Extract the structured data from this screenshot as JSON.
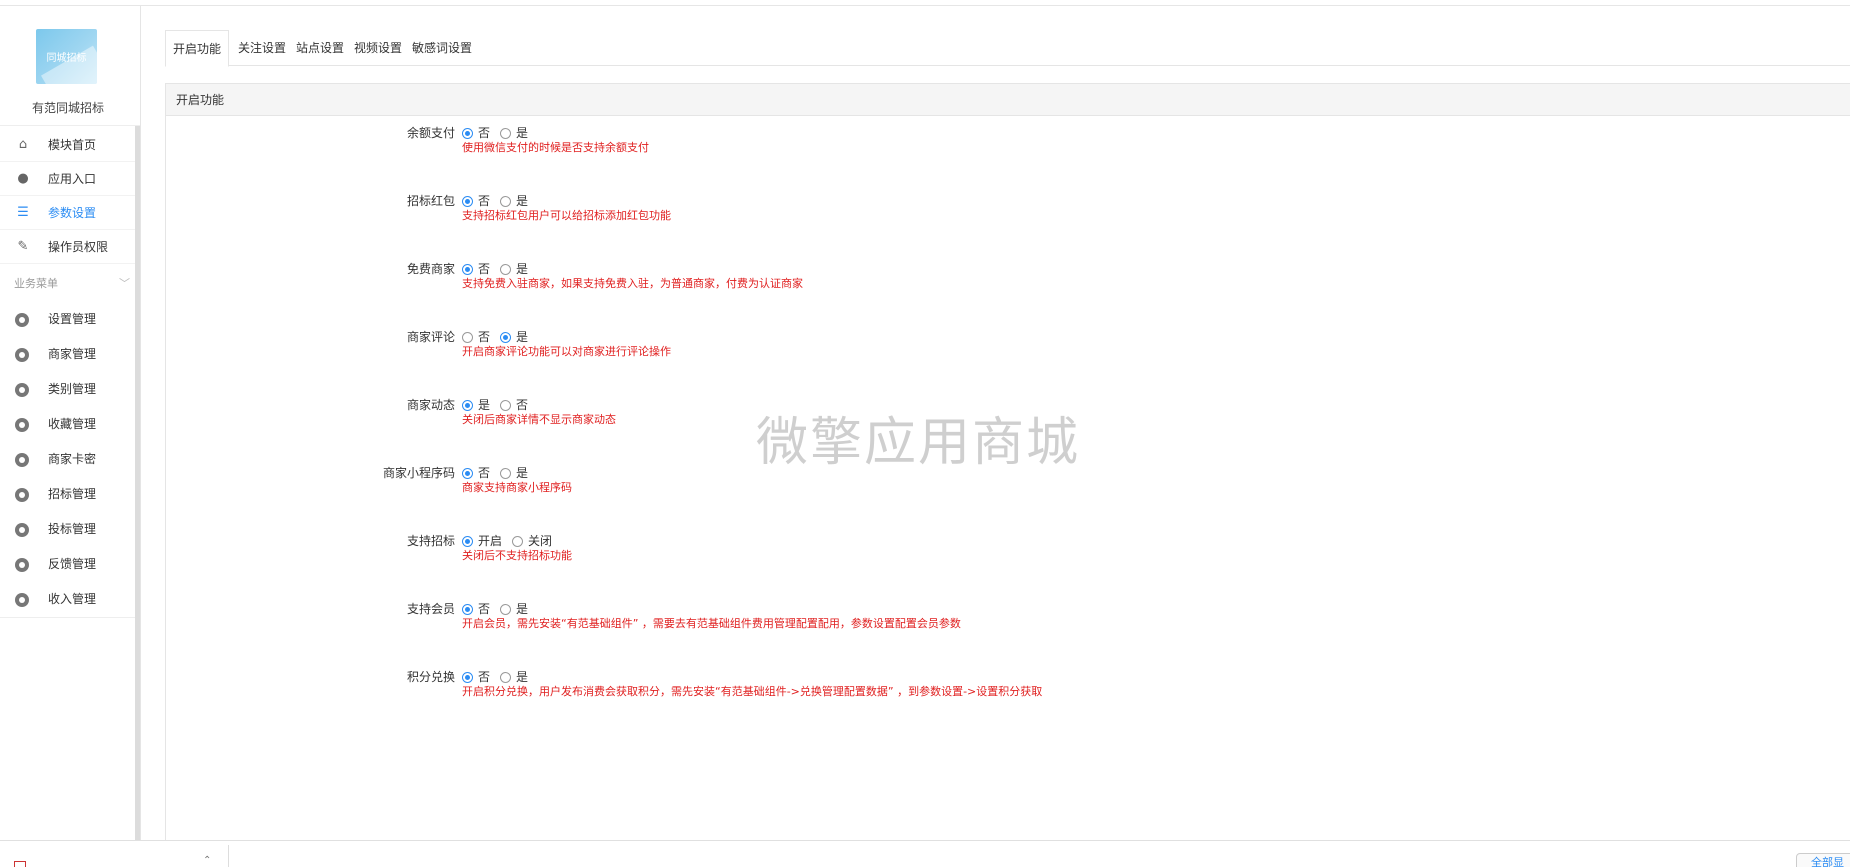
{
  "brand": {
    "logo_text": "同城招标",
    "name": "有范同城招标"
  },
  "nav": [
    {
      "label": "模块首页",
      "icon": "home-icon",
      "active": false
    },
    {
      "label": "应用入口",
      "icon": "chat-icon",
      "active": false
    },
    {
      "label": "参数设置",
      "icon": "list-icon",
      "active": true
    },
    {
      "label": "操作员权限",
      "icon": "edit-icon",
      "active": false
    }
  ],
  "business_menu": {
    "title": "业务菜单",
    "items": [
      "设置管理",
      "商家管理",
      "类别管理",
      "收藏管理",
      "商家卡密",
      "招标管理",
      "投标管理",
      "反馈管理",
      "收入管理"
    ]
  },
  "tabs": [
    "开启功能",
    "关注设置",
    "站点设置",
    "视频设置",
    "敏感词设置"
  ],
  "panel_title": "开启功能",
  "settings": [
    {
      "label": "余额支付",
      "options": [
        "否",
        "是"
      ],
      "selected": 0,
      "hint": "使用微信支付的时候是否支持余额支付"
    },
    {
      "label": "招标红包",
      "options": [
        "否",
        "是"
      ],
      "selected": 0,
      "hint": "支持招标红包用户可以给招标添加红包功能"
    },
    {
      "label": "免费商家",
      "options": [
        "否",
        "是"
      ],
      "selected": 0,
      "hint": "支持免费入驻商家，如果支持免费入驻，为普通商家，付费为认证商家"
    },
    {
      "label": "商家评论",
      "options": [
        "否",
        "是"
      ],
      "selected": 1,
      "hint": "开启商家评论功能可以对商家进行评论操作"
    },
    {
      "label": "商家动态",
      "options": [
        "是",
        "否"
      ],
      "selected": 0,
      "hint": "关闭后商家详情不显示商家动态"
    },
    {
      "label": "商家小程序码",
      "options": [
        "否",
        "是"
      ],
      "selected": 0,
      "hint": "商家支持商家小程序码"
    },
    {
      "label": "支持招标",
      "options": [
        "开启",
        "关闭"
      ],
      "selected": 0,
      "hint": "关闭后不支持招标功能"
    },
    {
      "label": "支持会员",
      "options": [
        "否",
        "是"
      ],
      "selected": 0,
      "hint": "开启会员，需先安装“有范基础组件” ，需要去有范基础组件费用管理配置配用，参数设置配置会员参数"
    },
    {
      "label": "积分兑换",
      "options": [
        "否",
        "是"
      ],
      "selected": 0,
      "hint": "开启积分兑换，用户发布消费会获取积分，需先安装“有范基础组件->兑换管理配置数据” ，到参数设置->设置积分获取"
    }
  ],
  "watermark": "微擎应用商城",
  "bottom": {
    "all_label": "全部显"
  },
  "colors": {
    "accent": "#2b8cf3",
    "hint": "#e02020"
  }
}
